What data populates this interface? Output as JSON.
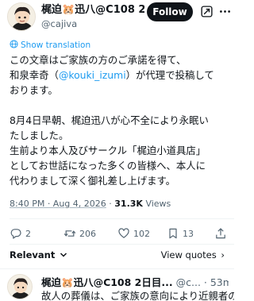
{
  "author": {
    "display_name": "梶迫🐹迅八@C108 2...",
    "handle": "@cajiva",
    "avatar_icon": "character-avatar-icon"
  },
  "header": {
    "follow_label": "Follow",
    "grok_icon": "grok-icon",
    "more_icon": "more-dots-icon"
  },
  "translation": {
    "label": "Show translation"
  },
  "post": {
    "line1": "この文章はご家族の方のご承諾を得て、",
    "line2_pre": "和泉幸奇（",
    "line2_mention": "@kouki_izumi",
    "line2_post": "）が代理で投稿して",
    "line3": "おります。",
    "line4": "8月4日早朝、梶迫迅八が心不全により永眠い",
    "line5": "たしました。",
    "line6": "生前より本人及びサークル「梶迫小道具店」",
    "line7": "としてお世話になった多くの皆様へ、本人に",
    "line8": "代わりまして深く御礼差し上げます。"
  },
  "meta": {
    "timestamp": "8:40 PM · Aug 4, 2026",
    "separator": "·",
    "views_count": "31.3K",
    "views_label": "Views"
  },
  "actions": {
    "replies": "2",
    "reposts": "206",
    "likes": "102",
    "bookmarks": "13"
  },
  "footer": {
    "relevant_label": "Relevant",
    "view_quotes_label": "View quotes",
    "view_quotes_arrow": "›"
  },
  "reply": {
    "display_name": "梶迫🐹迅八@C108 2日目...",
    "meta": "@c... · 53m",
    "text": "故人の葬儀は、ご家族の意向により近親者の"
  },
  "colors": {
    "accent": "#1d9bf0",
    "text": "#0f1419",
    "muted": "#536471",
    "follow_bg": "#0f1419"
  }
}
